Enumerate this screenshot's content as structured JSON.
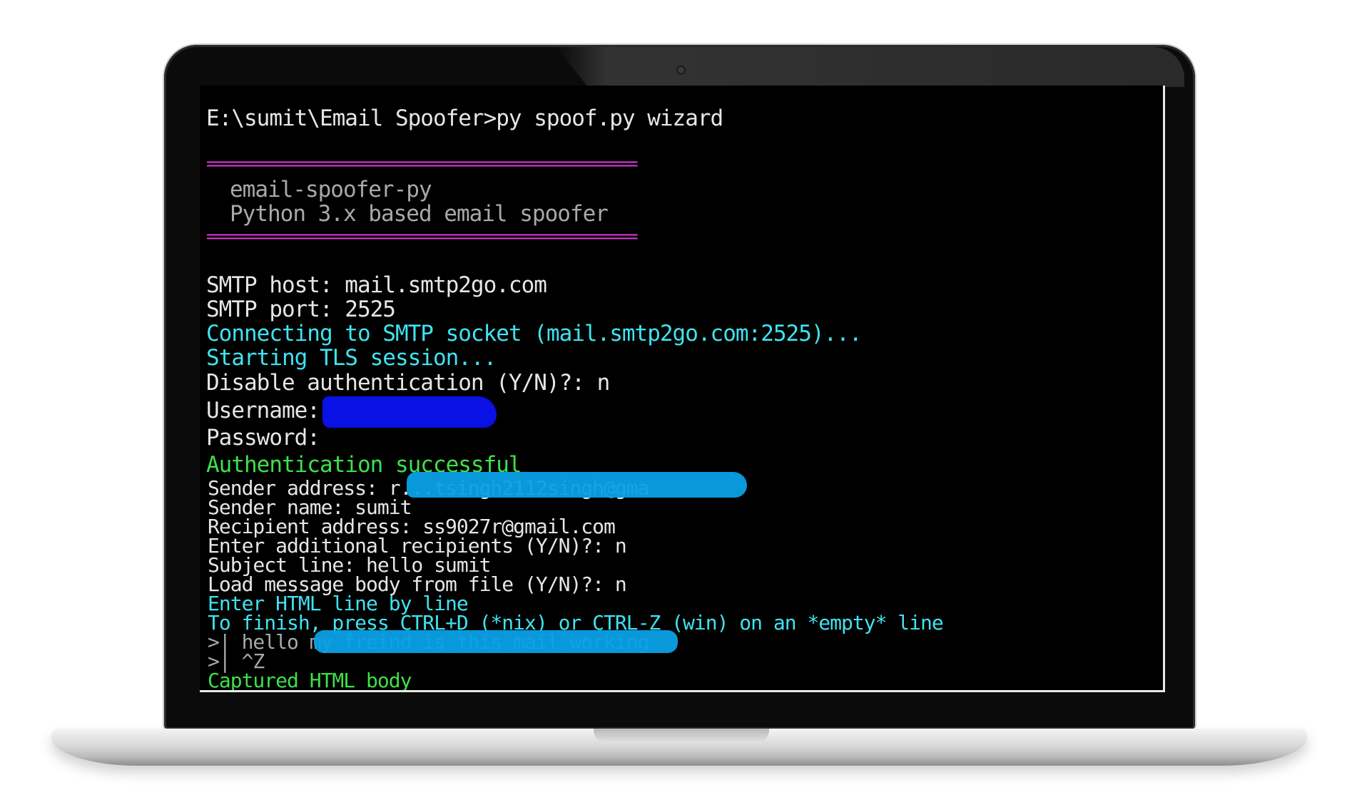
{
  "terminal": {
    "command": "E:\\sumit\\Email Spoofer>py spoof.py wizard",
    "rule": "==================================================",
    "banner_title": "email-spoofer-py",
    "banner_subtitle": "Python 3.x based email spoofer",
    "smtp_host": "SMTP host: mail.smtp2go.com",
    "smtp_port": "SMTP port: 2525",
    "connecting": "Connecting to SMTP socket (mail.smtp2go.com:2525)...",
    "tls": "Starting TLS session...",
    "disable_auth": "Disable authentication (Y/N)?: n",
    "username_label": "Username: ",
    "password_label": "Password:",
    "auth_success": "Authentication successful",
    "sender_address": "Sender address: r...tsingh2112singh@gma",
    "sender_name": "Sender name: sumit",
    "recipient_address": "Recipient address: ss9027r@gmail.com",
    "additional_recipients": "Enter additional recipients (Y/N)?: n",
    "subject_line": "Subject line: hello sumit",
    "load_body": "Load message body from file (Y/N)?: n",
    "enter_html": "Enter HTML line by line",
    "finish_hint": "To finish, press CTRL+D (*nix) or CTRL-Z (win) on an *empty* line",
    "body_line1": ">| hello my freind is this mail working",
    "body_line2": ">| ^Z",
    "captured": "Captured HTML body"
  },
  "colors": {
    "white": "#e6e6e6",
    "gray": "#a9a9a9",
    "cyan": "#3fe3f0",
    "green": "#3ee04a",
    "magenta": "#d23ad0",
    "redact_blue": "#0a12f0",
    "redact_cyan": "#0aa0e6"
  }
}
